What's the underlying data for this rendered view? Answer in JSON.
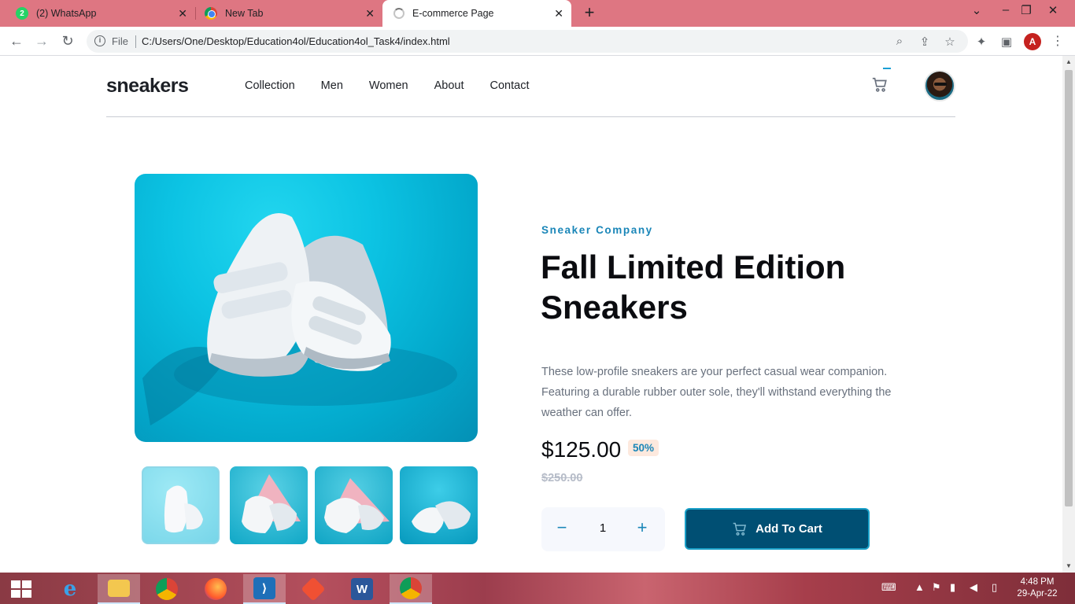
{
  "browser": {
    "tabs": [
      {
        "title": "(2) WhatsApp",
        "icon": "whatsapp-icon",
        "badge": "2"
      },
      {
        "title": "New Tab",
        "icon": "chrome-icon"
      },
      {
        "title": "E-commerce Page",
        "icon": "loading-icon",
        "active": true
      }
    ],
    "address": {
      "scheme_label": "File",
      "url": "C:/Users/One/Desktop/Education4ol/Education4ol_Task4/index.html"
    },
    "profile_initial": "A"
  },
  "site": {
    "logo": "sneakers",
    "nav": [
      "Collection",
      "Men",
      "Women",
      "About",
      "Contact"
    ],
    "cart_icon": "cart-icon"
  },
  "product": {
    "company": "Sneaker Company",
    "title": "Fall Limited Edition Sneakers",
    "description": "These low-profile sneakers are your perfect casual wear companion. Featuring a durable rubber outer sole, they'll withstand everything the weather can offer.",
    "price": "$125.00",
    "discount": "50%",
    "old_price": "$250.00",
    "quantity": "1",
    "add_to_cart": "Add To Cart",
    "thumbnail_count": 4,
    "selected_thumbnail": 1
  },
  "taskbar": {
    "apps": [
      "internet-explorer-icon",
      "file-explorer-icon",
      "chrome-icon",
      "firefox-icon",
      "vscode-icon",
      "git-icon",
      "word-icon",
      "chrome-profile-icon"
    ],
    "time": "4:48 PM",
    "date": "29-Apr-22"
  }
}
